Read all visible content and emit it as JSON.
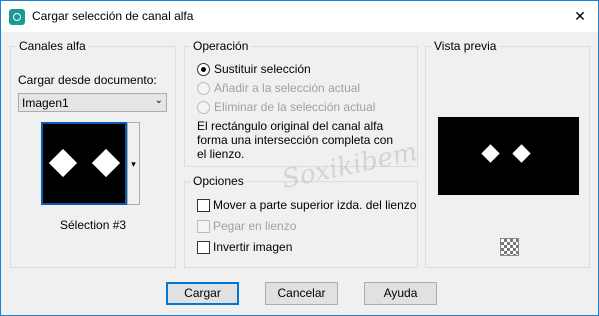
{
  "window": {
    "title": "Cargar selección de canal alfa",
    "close_glyph": "✕"
  },
  "canales": {
    "title": "Canales alfa",
    "load_from_label": "Cargar desde documento:",
    "document_value": "Imagen1",
    "selection_name": "Sélection #3",
    "dropdown_glyph": "⌄",
    "split_glyph": "▾"
  },
  "operacion": {
    "title": "Operación",
    "options": [
      {
        "label": "Sustituir selección",
        "selected": true,
        "enabled": true
      },
      {
        "label": "Añadir a la selección actual",
        "selected": false,
        "enabled": false
      },
      {
        "label": "Eliminar de la selección actual",
        "selected": false,
        "enabled": false
      }
    ],
    "description": "El rectángulo original del canal alfa forma una intersección completa con el lienzo."
  },
  "opciones": {
    "title": "Opciones",
    "checks": [
      {
        "label": "Mover a parte superior izda. del lienzo",
        "checked": false,
        "enabled": true
      },
      {
        "label": "Pegar en lienzo",
        "checked": false,
        "enabled": false
      },
      {
        "label": "Invertir imagen",
        "checked": false,
        "enabled": true
      }
    ]
  },
  "vista": {
    "title": "Vista previa"
  },
  "buttons": {
    "load": "Cargar",
    "cancel": "Cancelar",
    "help": "Ayuda"
  },
  "watermark": {
    "text": "Soxikibem"
  },
  "colors": {
    "accent": "#0078d7",
    "background": "#f0f0f0",
    "preview_bg": "#000000"
  }
}
